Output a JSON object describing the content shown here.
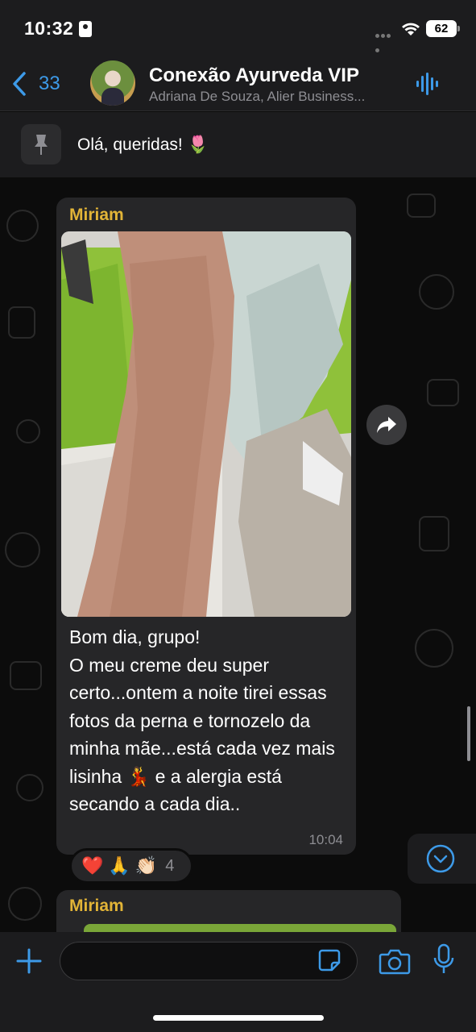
{
  "status_bar": {
    "time": "10:32",
    "battery": "62"
  },
  "header": {
    "back_count": "33",
    "title": "Conexão Ayurveda VIP",
    "subtitle": "Adriana De Souza, Alier Business..."
  },
  "pinned": {
    "text": "Olá, queridas! 🌷"
  },
  "message": {
    "sender": "Miriam",
    "text": "Bom dia, grupo!\nO meu creme deu super certo...ontem a noite tirei essas fotos da perna e tornozelo da minha mãe...está cada vez mais lisinha 💃 e a alergia está secando a cada dia..",
    "time": "10:04",
    "reactions": {
      "emojis": [
        "❤️",
        "🙏",
        "👏🏻"
      ],
      "count": "4"
    }
  },
  "next_message": {
    "sender": "Miriam"
  },
  "input": {
    "placeholder": "",
    "value": ""
  },
  "colors": {
    "accent": "#3d9ae8",
    "sender": "#e2b437",
    "bubble": "#262628",
    "bar": "#1c1c1e"
  }
}
